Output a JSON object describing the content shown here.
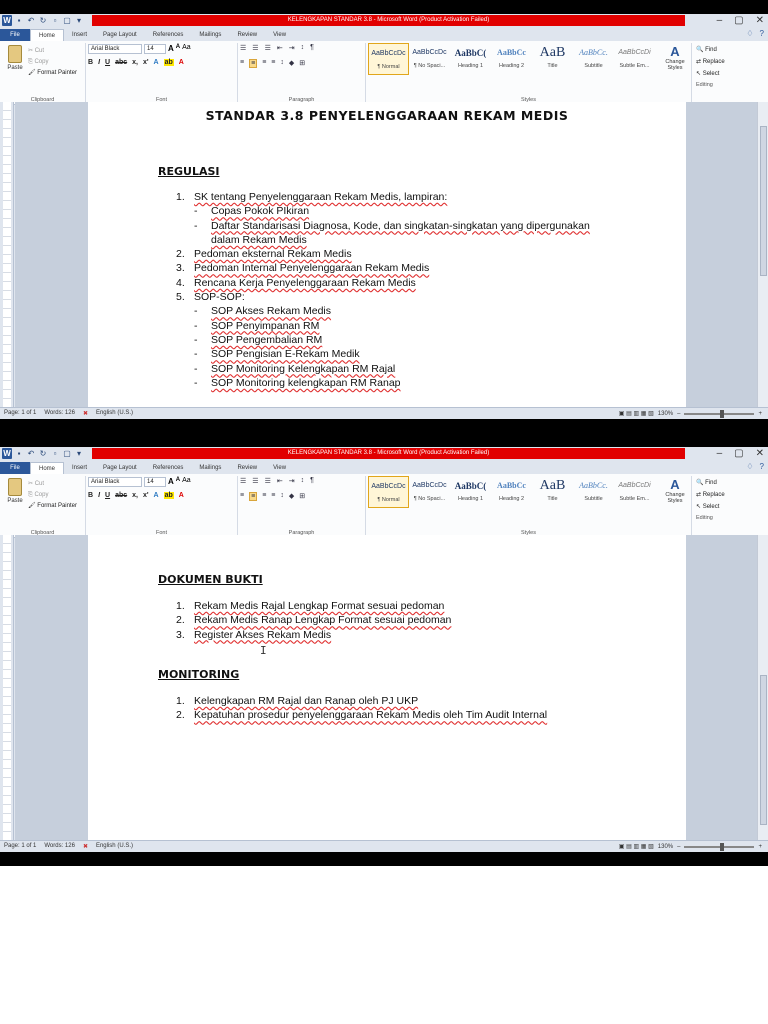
{
  "window": {
    "title": "KELENGKAPAN STANDAR 3.8 - Microsoft Word (Product Activation Failed)",
    "controls": [
      "–",
      "▢",
      "✕"
    ],
    "help": [
      "♢",
      "?"
    ]
  },
  "qat_icons": [
    "W",
    "💾",
    "↶",
    "↻",
    "🔍",
    "▢",
    "▾"
  ],
  "tabs": [
    "File",
    "Home",
    "Insert",
    "Page Layout",
    "References",
    "Mailings",
    "Review",
    "View"
  ],
  "ribbon": {
    "clipboard": {
      "paste": "Paste",
      "cut": "Cut",
      "copy": "Copy",
      "format_painter": "Format Painter",
      "label": "Clipboard"
    },
    "font": {
      "name": "Arial Black",
      "size": "14",
      "grow": "A",
      "shrink": "A",
      "case": "Aa",
      "label": "Font",
      "bold": "B",
      "italic": "I",
      "underline": "U",
      "strike": "abc",
      "sub": "x,",
      "sup": "x'",
      "effects": "A",
      "highlight": "ab",
      "color": "A"
    },
    "paragraph": {
      "label": "Paragraph",
      "row1": [
        "☰",
        "☰",
        "☰",
        "⇤",
        "⇥",
        "↕",
        "¶"
      ],
      "row2": [
        "≡",
        "≡",
        "≡",
        "≡",
        "↕",
        "◆",
        "⊞"
      ]
    },
    "styles": {
      "label": "Styles",
      "items": [
        {
          "sample": "AaBbCcDc",
          "name": "¶ Normal",
          "selected": true
        },
        {
          "sample": "AaBbCcDc",
          "name": "¶ No Spaci..."
        },
        {
          "sample": "AaBbC(",
          "name": "Heading 1"
        },
        {
          "sample": "AaBbCc",
          "name": "Heading 2"
        },
        {
          "sample": "AaB",
          "name": "Title"
        },
        {
          "sample": "AaBbCc.",
          "name": "Subtitle"
        },
        {
          "sample": "AaBbCcDi",
          "name": "Subtle Em..."
        }
      ],
      "change_styles": "Change Styles",
      "change_icon": "A"
    },
    "editing": {
      "find": "Find",
      "replace": "Replace",
      "select": "Select",
      "label": "Editing"
    }
  },
  "ruler_tab": "L",
  "status": {
    "page": "Page: 1 of 1",
    "words": "Words: 126",
    "lang": "English (U.S.)",
    "zoom": "130%",
    "zoom_minus": "–",
    "zoom_plus": "+"
  },
  "doc": {
    "title": "STANDAR 3.8 PENYELENGGARAAN REKAM MEDIS",
    "regulasi": {
      "heading": "REGULASI",
      "items": [
        {
          "num": "1.",
          "text": "SK tentang Penyelenggaraan Rekam Medis, lampiran:"
        },
        {
          "num": "2.",
          "text": "Pedoman eksternal Rekam Medis"
        },
        {
          "num": "3.",
          "text": "Pedoman Internal Penyelenggaraan Rekam Medis"
        },
        {
          "num": "4.",
          "text": "Rencana Kerja Penyelenggaraan Rekam Medis"
        },
        {
          "num": "5.",
          "text": "SOP-SOP:"
        }
      ],
      "sub1": [
        "Copas Pokok PIkiran",
        "Daftar Standarisasi Diagnosa, Kode, dan singkatan-singkatan yang dipergunakan",
        "dalam Rekam Medis"
      ],
      "sub5": [
        "SOP Akses Rekam Medis",
        "SOP Penyimpanan RM",
        "SOP Pengembalian RM",
        "SOP Pengisian E-Rekam Medik",
        "SOP Monitoring Kelengkapan RM Rajal",
        "SOP Monitoring kelengkapan RM Ranap"
      ],
      "dash": "-"
    },
    "dokumen": {
      "heading": "DOKUMEN BUKTI",
      "items": [
        {
          "num": "1.",
          "text": "Rekam Medis Rajal Lengkap Format sesuai pedoman"
        },
        {
          "num": "2.",
          "text": "Rekam Medis Ranap Lengkap Format sesuai pedoman"
        },
        {
          "num": "3.",
          "text": "Register Akses Rekam Medis"
        }
      ]
    },
    "monitoring": {
      "heading": "MONITORING",
      "items": [
        {
          "num": "1.",
          "text": "Kelengkapan RM Rajal dan Ranap oleh PJ UKP"
        },
        {
          "num": "2.",
          "text": "Kepatuhan prosedur penyelenggaraan Rekam Medis oleh Tim Audit Internal"
        }
      ]
    },
    "cursor": "I"
  },
  "colors": {
    "title_bar_red": "#e10000",
    "file_tab": "#2b579a",
    "chrome": "#dfe5ee",
    "doc_bg": "#c6cfdc"
  }
}
